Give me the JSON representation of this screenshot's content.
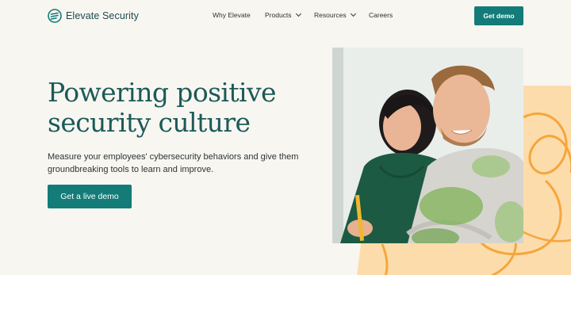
{
  "brand": {
    "name_main": "Elevate",
    "name_suffix": "Security",
    "logo_icon": "elevate-logo-icon"
  },
  "nav": {
    "items": [
      {
        "label": "Why Elevate",
        "dropdown": false
      },
      {
        "label": "Products",
        "dropdown": true
      },
      {
        "label": "Resources",
        "dropdown": true
      },
      {
        "label": "Careers",
        "dropdown": false
      }
    ],
    "cta_label": "Get demo"
  },
  "hero": {
    "headline_line1": "Powering positive",
    "headline_line2": "security culture",
    "subtext": "Measure your employees' cybersecurity behaviors and give them groundbreaking tools to learn and improve.",
    "cta_label": "Get a live demo"
  },
  "colors": {
    "accent": "#137c78",
    "headline": "#1c5a58",
    "background": "#f8f6f1",
    "peach": "#fde0b3",
    "orange_swirl": "#f4a53b"
  }
}
